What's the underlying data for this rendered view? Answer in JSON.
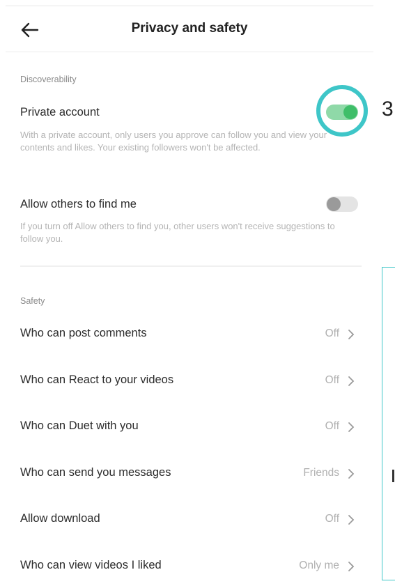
{
  "header": {
    "title": "Privacy and safety",
    "back_icon": "arrow-left-icon"
  },
  "discoverability": {
    "section_label": "Discoverability",
    "private_account": {
      "title": "Private account",
      "description": "With a private account, only users you approve can follow you and view your contents and likes. Your existing followers won't be affected.",
      "enabled": true
    },
    "allow_find": {
      "title": "Allow others to find me",
      "description": "If you turn off Allow others to find you, other users won't receive suggestions to follow you.",
      "enabled": false
    }
  },
  "annotation": {
    "step": "3",
    "ring_color": "#3ec6c8"
  },
  "safety": {
    "section_label": "Safety",
    "items": [
      {
        "label": "Who can post comments",
        "value": "Off"
      },
      {
        "label": "Who can React to your videos",
        "value": "Off"
      },
      {
        "label": "Who can Duet with you",
        "value": "Off"
      },
      {
        "label": "Who can send you messages",
        "value": "Friends"
      },
      {
        "label": "Allow download",
        "value": "Off"
      },
      {
        "label": "Who can view videos I liked",
        "value": "Only me"
      }
    ]
  },
  "colors": {
    "toggle_on": "#3fbe69",
    "toggle_on_track": "#8fd9a8",
    "toggle_off": "#9a9a9a",
    "accent": "#3ec6c8"
  }
}
